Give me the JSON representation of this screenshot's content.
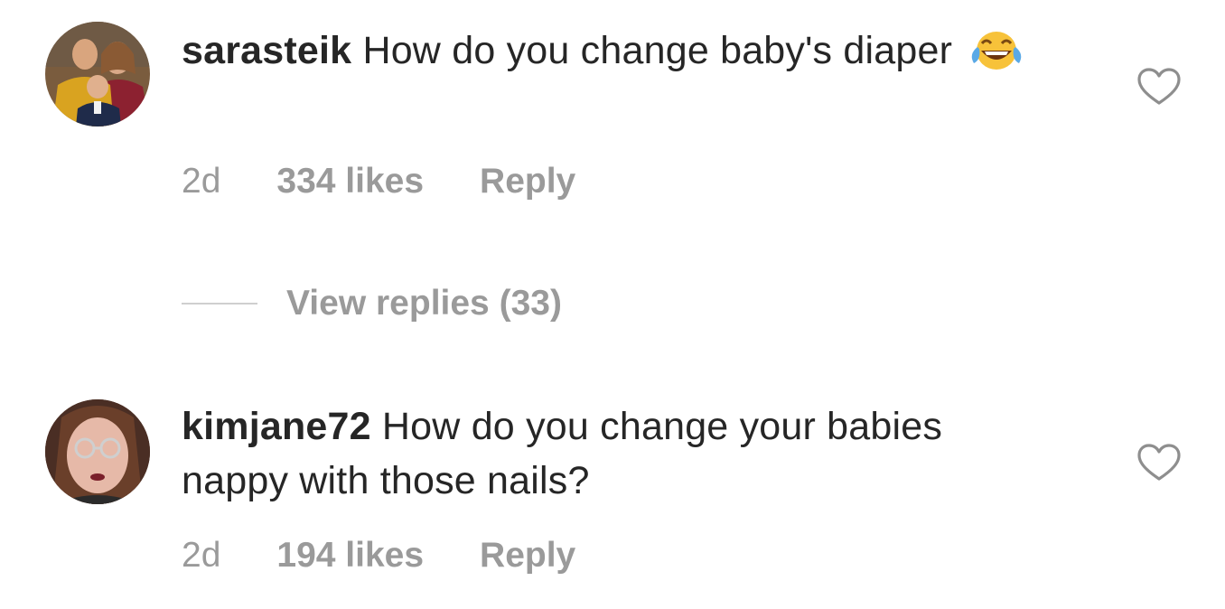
{
  "comments": [
    {
      "username": "sarasteik",
      "text": " How do you change baby's diaper",
      "emoji": "face-with-tears-of-joy-icon",
      "time": "2d",
      "likes": "334 likes",
      "reply": "Reply"
    },
    {
      "username": "kimjane72",
      "text": " How do you change your babies nappy with those nails?",
      "time": "2d",
      "likes": "194 likes",
      "reply": "Reply"
    }
  ],
  "view_replies": {
    "label": "View replies (33)"
  },
  "colors": {
    "text": "#262626",
    "meta": "#9a9a9a",
    "divider": "#cfcfcf",
    "emoji_face": "#f7c23a"
  }
}
